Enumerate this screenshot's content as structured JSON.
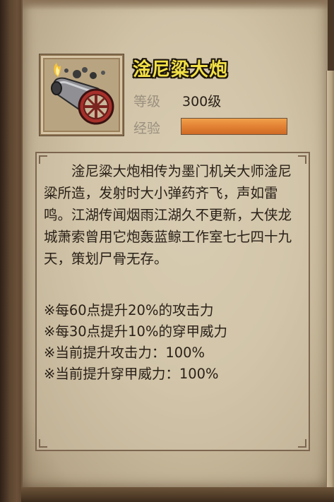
{
  "item": {
    "name": "淦尼粱大炮",
    "icon": "cannon-icon",
    "level_label": "等级",
    "level_value": "300级",
    "exp_label": "经验",
    "exp_fraction": 1.0
  },
  "description": "淦尼粱大炮相传为墨门机关大师淦尼粱所造，发射时大小弹药齐飞，声如雷鸣。江湖传闻烟雨江湖久不更新，大侠龙城萧索曾用它炮轰蓝鲸工作室七七四十九天，策划尸骨无存。",
  "effects": [
    "※每60点提升20%的攻击力",
    "※每30点提升10%的穿甲威力",
    "※当前提升攻击力：100%",
    "※当前提升穿甲威力：100%"
  ],
  "colors": {
    "name_text": "#f2e046",
    "exp_bar": "#e48436",
    "parchment": "#d0c2a5"
  }
}
